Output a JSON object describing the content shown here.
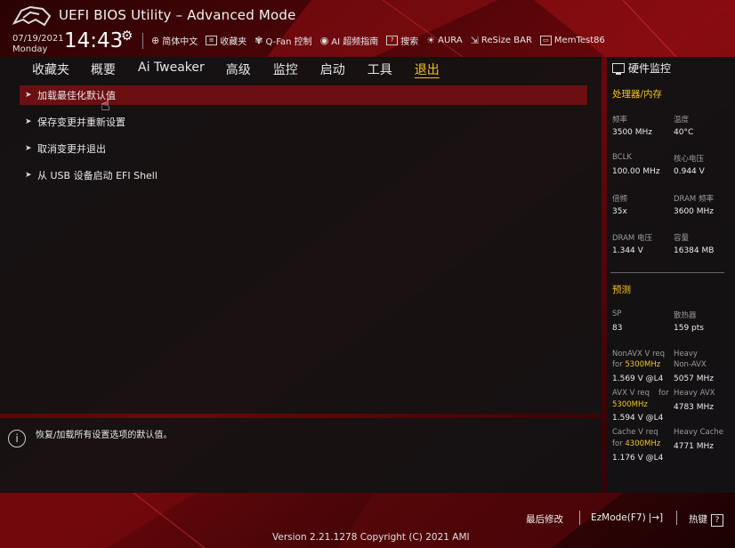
{
  "header": {
    "title": "UEFI BIOS Utility – Advanced Mode",
    "date": "07/19/2021",
    "day": "Monday",
    "time": "14:43"
  },
  "toolbar": [
    {
      "icon": "globe-icon",
      "label": "简体中文"
    },
    {
      "icon": "bookmark-icon",
      "label": "收藏夹"
    },
    {
      "icon": "fan-icon",
      "label": "Q-Fan 控制"
    },
    {
      "icon": "ai-overclock-icon",
      "label": "AI 超频指南"
    },
    {
      "icon": "search-icon",
      "label": "搜索"
    },
    {
      "icon": "aura-icon",
      "label": "AURA"
    },
    {
      "icon": "resize-bar-icon",
      "label": "ReSize BAR"
    },
    {
      "icon": "memtest-icon",
      "label": "MemTest86"
    }
  ],
  "tabs": [
    {
      "label": "收藏夹",
      "active": false
    },
    {
      "label": "概要",
      "active": false
    },
    {
      "label": "Ai Tweaker",
      "active": false
    },
    {
      "label": "高级",
      "active": false
    },
    {
      "label": "监控",
      "active": false
    },
    {
      "label": "启动",
      "active": false
    },
    {
      "label": "工具",
      "active": false
    },
    {
      "label": "退出",
      "active": true
    }
  ],
  "menu": [
    {
      "label": "加载最佳化默认值",
      "selected": true
    },
    {
      "label": "保存变更并重新设置",
      "selected": false
    },
    {
      "label": "取消变更并退出",
      "selected": false
    },
    {
      "label": "从 USB 设备启动 EFI Shell",
      "selected": false
    }
  ],
  "help": {
    "text": "恢复/加载所有设置选项的默认值。"
  },
  "hw_monitor": {
    "title": "硬件监控",
    "cpu_mem_section": "处理器/内存",
    "items": [
      {
        "label": "频率",
        "value": "3500 MHz"
      },
      {
        "label": "温度",
        "value": "40°C"
      },
      {
        "label": "BCLK",
        "value": "100.00 MHz"
      },
      {
        "label": "核心电压",
        "value": "0.944 V"
      },
      {
        "label": "倍频",
        "value": "35x"
      },
      {
        "label": "DRAM 频率",
        "value": "3600 MHz"
      },
      {
        "label": "DRAM 电压",
        "value": "1.344 V"
      },
      {
        "label": "容量",
        "value": "16384 MB"
      }
    ],
    "prediction_section": "预测",
    "sp": {
      "label": "SP",
      "value": "83"
    },
    "cooler": {
      "label": "散热器",
      "value": "159 pts"
    },
    "nonavx": {
      "label1": "NonAVX V req",
      "label2_pre": "for ",
      "freq": "5300MHz",
      "value": "1.569 V @L4",
      "heavy_label1": "Heavy",
      "heavy_label2": "Non-AVX",
      "heavy_value": "5057 MHz"
    },
    "avx": {
      "label1": "AVX V req",
      "label1_for": "for",
      "freq": "5300MHz",
      "value": "1.594 V @L4",
      "heavy_label": "Heavy AVX",
      "heavy_value": "4783 MHz"
    },
    "cache": {
      "label1": "Cache V req",
      "label2_pre": "for ",
      "freq": "4300MHz",
      "value": "1.176 V @L4",
      "heavy_label": "Heavy Cache",
      "heavy_value": "4771 MHz"
    }
  },
  "footer": {
    "last_modified": "最后修改",
    "ezmode": "EzMode(F7)",
    "hotkeys": "热键",
    "hotkeys_box": "?",
    "version": "Version 2.21.1278 Copyright (C) 2021 AMI"
  },
  "colors": {
    "accent": "#f0c419",
    "selected_row": "#6b0f12",
    "panel": "#121214"
  }
}
